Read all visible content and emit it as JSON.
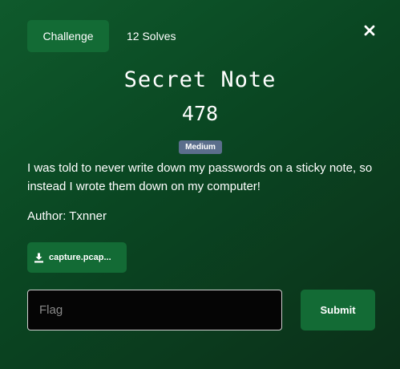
{
  "header": {
    "tabs": [
      {
        "label": "Challenge"
      },
      {
        "label": "12 Solves"
      }
    ],
    "close_icon": "close-icon"
  },
  "challenge": {
    "title": "Secret Note",
    "points": "478",
    "difficulty": "Medium",
    "description": "I was told to never write down my passwords on a sticky note, so instead I wrote them down on my computer!",
    "author": "Author: Txnner"
  },
  "files": [
    {
      "label": "capture.pcap...",
      "icon": "download-icon"
    }
  ],
  "form": {
    "flag_placeholder": "Flag",
    "flag_value": "",
    "submit_label": "Submit"
  },
  "colors": {
    "accent": "#136b35",
    "badge": "#5b6e8c",
    "background": "#0a4622"
  }
}
